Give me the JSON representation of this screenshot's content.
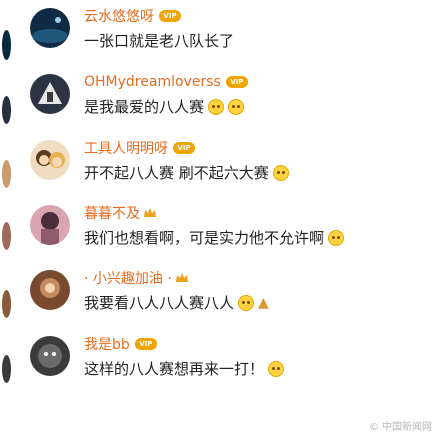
{
  "colors": {
    "username": "#e86c1f",
    "vip_badge": "#f0a400",
    "comment": "#222222"
  },
  "comments": [
    {
      "username": "云水悠悠呀",
      "badge": "vip",
      "comment": "一张口就是老八队长了",
      "emojis": []
    },
    {
      "username": "OHMydreamloverss",
      "badge": "vip",
      "comment": "是我最爱的八人赛",
      "emojis": [
        "smile-emoji",
        "smile-emoji"
      ]
    },
    {
      "username": "工具人明明呀",
      "badge": "vip",
      "comment": "开不起八人赛 刷不起六大赛",
      "emojis": [
        "smile-emoji"
      ]
    },
    {
      "username": "暮暮不及",
      "badge": "crown",
      "comment": "我们也想看啊，可是实力他不允许啊",
      "emojis": [
        "smile-emoji"
      ]
    },
    {
      "username": "· 小兴趣加油 ·",
      "badge": "crown",
      "comment": "我要看八人八人赛八人",
      "emojis": [
        "smile-emoji",
        "thumb-emoji"
      ]
    },
    {
      "username": "我是bb",
      "badge": "vip",
      "comment": "这样的八人赛想再来一打！",
      "emojis": [
        "laugh-emoji"
      ]
    }
  ],
  "watermark": "© 中国新闻网"
}
